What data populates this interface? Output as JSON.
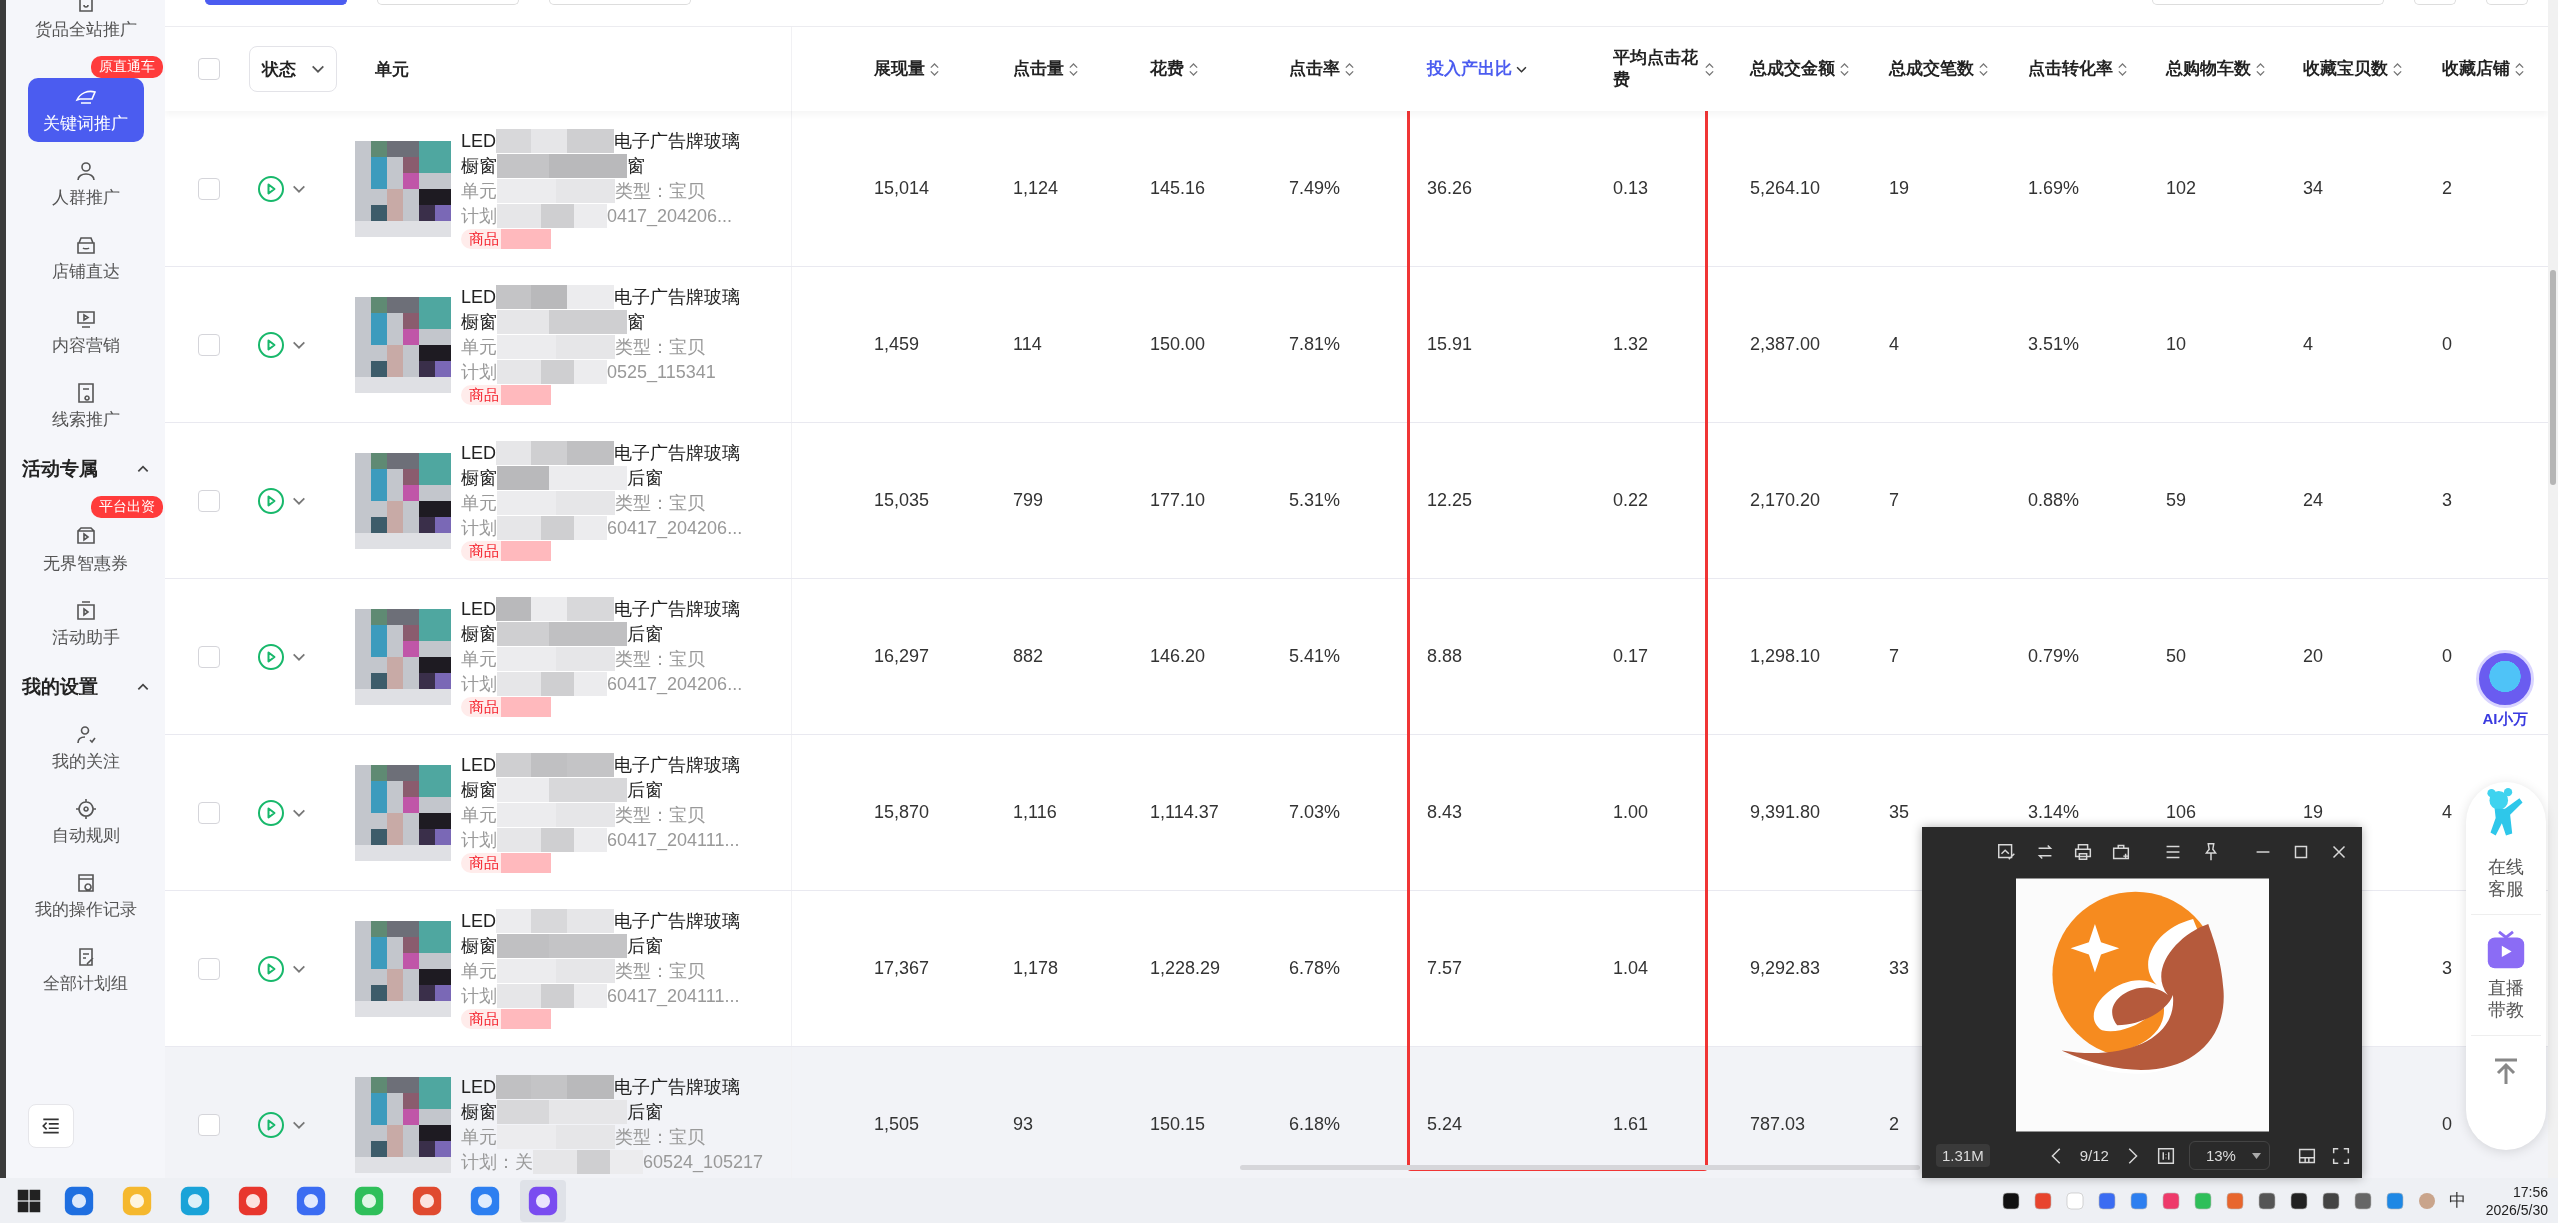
{
  "sidebar": {
    "items": [
      {
        "kind": "item",
        "label": "货品全站推广",
        "selected": false
      },
      {
        "kind": "item",
        "label": "关键词推广",
        "selected": true,
        "badge": "原直通车"
      },
      {
        "kind": "item",
        "label": "人群推广",
        "selected": false
      },
      {
        "kind": "item",
        "label": "店铺直达",
        "selected": false
      },
      {
        "kind": "item",
        "label": "内容营销",
        "selected": false
      },
      {
        "kind": "item",
        "label": "线索推广",
        "selected": false
      },
      {
        "kind": "section",
        "label": "活动专属",
        "expanded": true
      },
      {
        "kind": "item",
        "label": "无界智惠券",
        "selected": false,
        "badge": "平台出资"
      },
      {
        "kind": "item",
        "label": "活动助手",
        "selected": false
      },
      {
        "kind": "section",
        "label": "我的设置",
        "expanded": true
      },
      {
        "kind": "item",
        "label": "我的关注",
        "selected": false
      },
      {
        "kind": "item",
        "label": "自动规则",
        "selected": false
      },
      {
        "kind": "item",
        "label": "我的操作记录",
        "selected": false
      },
      {
        "kind": "item",
        "label": "全部计划组",
        "selected": false
      }
    ]
  },
  "table": {
    "all_checked": false,
    "status_filter": "状态",
    "unit_header": "单元",
    "columns": [
      {
        "label": "展现量",
        "sorted": false,
        "boxed": false
      },
      {
        "label": "点击量",
        "sorted": false,
        "boxed": false
      },
      {
        "label": "花费",
        "sorted": false,
        "boxed": false
      },
      {
        "label": "点击率",
        "sorted": false,
        "boxed": false
      },
      {
        "label": "投入产出比",
        "sorted": true,
        "boxed": true
      },
      {
        "label": "平均点击花费",
        "sorted": false,
        "boxed": true
      },
      {
        "label": "总成交金额",
        "sorted": false,
        "boxed": false
      },
      {
        "label": "总成交笔数",
        "sorted": false,
        "boxed": false
      },
      {
        "label": "点击转化率",
        "sorted": false,
        "boxed": false
      },
      {
        "label": "总购物车数",
        "sorted": false,
        "boxed": false
      },
      {
        "label": "收藏宝贝数",
        "sorted": false,
        "boxed": false
      },
      {
        "label": "收藏店铺",
        "sorted": false,
        "boxed": false
      }
    ],
    "rows": [
      {
        "checked": false,
        "running": true,
        "hovered": false,
        "unit": {
          "name_start": "LED",
          "name_end": "电子广告牌玻璃",
          "line2_start": "橱窗",
          "line2_end": "窗",
          "unit_prefix": "单元",
          "type": "类型：宝贝",
          "plan_prefix": "计划",
          "plan_end": "0417_204206...",
          "tag": "商品"
        },
        "values": [
          "15,014",
          "1,124",
          "145.16",
          "7.49%",
          "36.26",
          "0.13",
          "5,264.10",
          "19",
          "1.69%",
          "102",
          "34",
          "2"
        ]
      },
      {
        "checked": false,
        "running": true,
        "hovered": false,
        "unit": {
          "name_start": "LED",
          "name_end": "电子广告牌玻璃",
          "line2_start": "橱窗",
          "line2_end": "窗",
          "unit_prefix": "单元",
          "type": "类型：宝贝",
          "plan_prefix": "计划",
          "plan_end": "0525_115341",
          "tag": "商品"
        },
        "values": [
          "1,459",
          "114",
          "150.00",
          "7.81%",
          "15.91",
          "1.32",
          "2,387.00",
          "4",
          "3.51%",
          "10",
          "4",
          "0"
        ]
      },
      {
        "checked": false,
        "running": true,
        "hovered": false,
        "unit": {
          "name_start": "LED",
          "name_end": "电子广告牌玻璃",
          "line2_start": "橱窗",
          "line2_end": "后窗",
          "unit_prefix": "单元",
          "type": "类型：宝贝",
          "plan_prefix": "计划",
          "plan_end": "60417_204206...",
          "tag": "商品"
        },
        "values": [
          "15,035",
          "799",
          "177.10",
          "5.31%",
          "12.25",
          "0.22",
          "2,170.20",
          "7",
          "0.88%",
          "59",
          "24",
          "3"
        ]
      },
      {
        "checked": false,
        "running": true,
        "hovered": false,
        "unit": {
          "name_start": "LED",
          "name_end": "电子广告牌玻璃",
          "line2_start": "橱窗",
          "line2_end": "后窗",
          "unit_prefix": "单元",
          "type": "类型：宝贝",
          "plan_prefix": "计划",
          "plan_end": "60417_204206...",
          "tag": "商品"
        },
        "values": [
          "16,297",
          "882",
          "146.20",
          "5.41%",
          "8.88",
          "0.17",
          "1,298.10",
          "7",
          "0.79%",
          "50",
          "20",
          "0"
        ]
      },
      {
        "checked": false,
        "running": true,
        "hovered": false,
        "unit": {
          "name_start": "LED",
          "name_end": "电子广告牌玻璃",
          "line2_start": "橱窗",
          "line2_end": "后窗",
          "unit_prefix": "单元",
          "type": "类型：宝贝",
          "plan_prefix": "计划",
          "plan_end": "60417_204111...",
          "tag": "商品"
        },
        "values": [
          "15,870",
          "1,116",
          "1,114.37",
          "7.03%",
          "8.43",
          "1.00",
          "9,391.80",
          "35",
          "3.14%",
          "106",
          "19",
          "4"
        ]
      },
      {
        "checked": false,
        "running": true,
        "hovered": false,
        "unit": {
          "name_start": "LED",
          "name_end": "电子广告牌玻璃",
          "line2_start": "橱窗",
          "line2_end": "后窗",
          "unit_prefix": "单元",
          "type": "类型：宝贝",
          "plan_prefix": "计划",
          "plan_end": "60417_204111...",
          "tag": "商品"
        },
        "values": [
          "17,367",
          "1,178",
          "1,228.29",
          "6.78%",
          "7.57",
          "1.04",
          "9,292.83",
          "33"
        ],
        "trailing_values": [
          "3"
        ]
      },
      {
        "checked": false,
        "running": true,
        "hovered": true,
        "unit": {
          "name_start": "LED",
          "name_end": "电子广告牌玻璃",
          "line2_start": "橱窗",
          "line2_end": "后窗",
          "unit_prefix": "单元",
          "type": "类型：宝贝",
          "plan_prefix": "计划：关",
          "plan_end": "60524_105217"
        },
        "values": [
          "1,505",
          "93",
          "150.15",
          "6.18%",
          "5.24",
          "1.61",
          "787.03",
          "2"
        ],
        "trailing_values": [
          "0"
        ]
      }
    ]
  },
  "float_panel": {
    "assistant": "AI小万",
    "service": "在线客服",
    "live": "直播带教"
  },
  "viewer": {
    "kind": "picture",
    "size": "1.31M",
    "page": "9/12",
    "zoom": "13%"
  },
  "taskbar": {
    "apps": [
      {
        "selected": false
      },
      {
        "selected": false
      },
      {
        "selected": false
      },
      {
        "selected": false
      },
      {
        "selected": false
      },
      {
        "selected": false
      },
      {
        "selected": false
      },
      {
        "selected": false
      },
      {
        "selected": true
      }
    ],
    "ime": "中",
    "time": "17:56",
    "date": "2026/5/30"
  }
}
